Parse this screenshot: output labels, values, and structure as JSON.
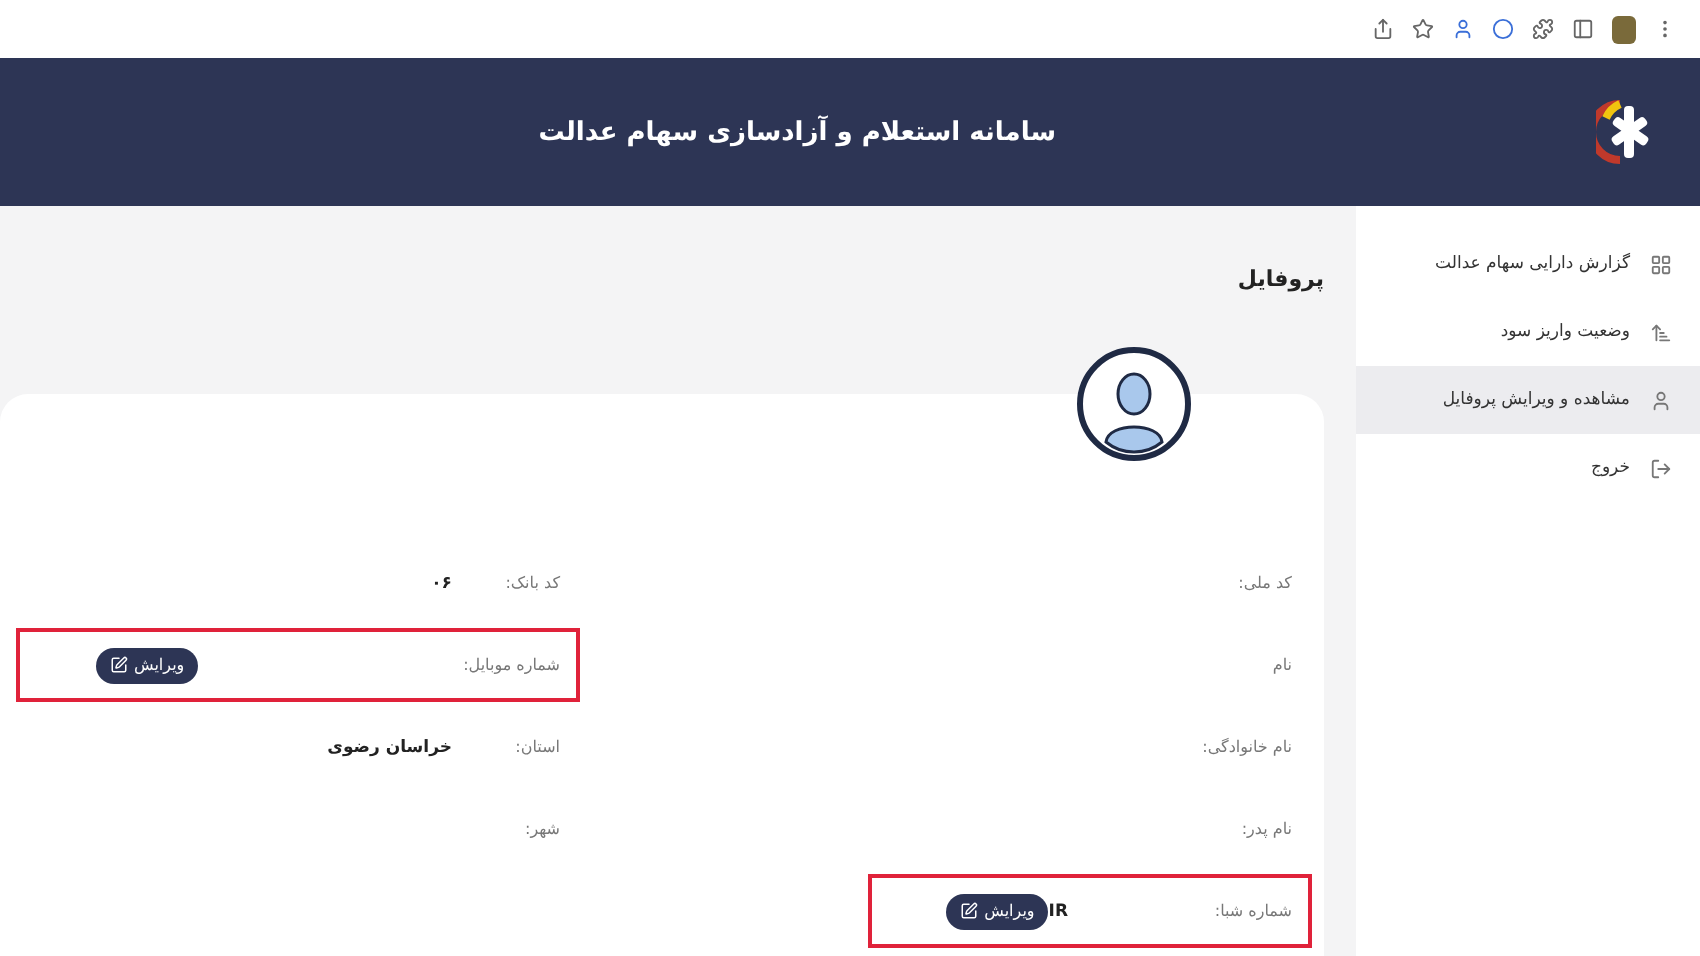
{
  "header": {
    "title": "سامانه استعلام و آزادسازی سهام عدالت"
  },
  "sidebar": {
    "items": [
      {
        "label": "گزارش دارایی سهام عدالت",
        "selected": false
      },
      {
        "label": "وضعیت واریز سود",
        "selected": false
      },
      {
        "label": "مشاهده و ویرایش پروفایل",
        "selected": true
      },
      {
        "label": "خروج",
        "selected": false
      }
    ]
  },
  "page_title": "پروفایل",
  "profile": {
    "columns": [
      {
        "fields": [
          {
            "label": "کد ملی:",
            "highlighted": false
          },
          {
            "label": "نام",
            "highlighted": false
          },
          {
            "label": "نام خانوادگی:",
            "highlighted": false
          },
          {
            "label": "نام پدر:",
            "highlighted": false
          },
          {
            "label": "شماره شبا:",
            "value": "IR",
            "button": "ویرایش",
            "highlighted": true
          }
        ]
      },
      {
        "fields": [
          {
            "label": "کد بانک:",
            "value": "۰۶",
            "highlighted": false
          },
          {
            "label": "شماره موبایل:",
            "button": "ویرایش",
            "highlighted": true
          },
          {
            "label": "استان:",
            "value": "خراسان رضوی",
            "highlighted": false
          },
          {
            "label": "شهر:",
            "highlighted": false
          }
        ]
      }
    ]
  }
}
